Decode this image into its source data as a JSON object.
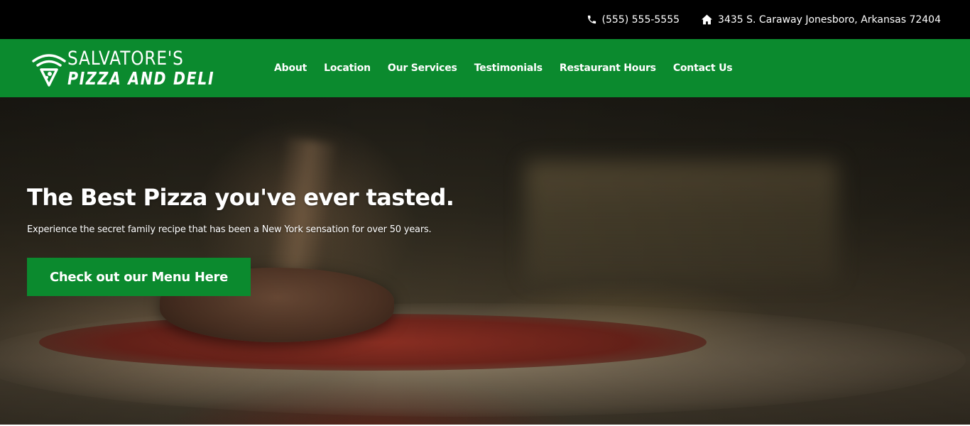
{
  "topbar": {
    "phone": "(555) 555-5555",
    "phone_icon": "phone-icon",
    "address": "3435 S. Caraway Jonesboro, Arkansas 72404",
    "address_icon": "home-icon"
  },
  "brand": {
    "line1": "SALVATORE'S",
    "line2": "PIZZA AND DELI",
    "logo_icon": "pizza-slice-wifi-icon"
  },
  "nav": {
    "items": [
      {
        "label": "About"
      },
      {
        "label": "Location"
      },
      {
        "label": "Our Services"
      },
      {
        "label": "Testimonials"
      },
      {
        "label": "Restaurant Hours"
      },
      {
        "label": "Contact Us"
      }
    ]
  },
  "hero": {
    "title": "The Best Pizza you've ever tasted.",
    "subtitle": "Experience the secret family recipe that has been a New York sensation for over 50 years.",
    "cta_label": "Check out our Menu Here"
  },
  "colors": {
    "topbar_bg": "#000000",
    "brand_green": "#0b8a2e",
    "text": "#ffffff"
  }
}
